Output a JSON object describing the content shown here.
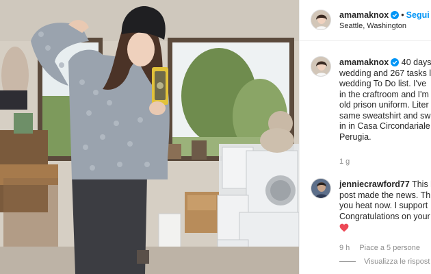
{
  "header": {
    "username": "amamaknox",
    "follow_label": "Segui",
    "location": "Seattle, Washington",
    "icons": {
      "verified": "verified-badge-icon",
      "avatar": "profile-avatar"
    }
  },
  "caption": {
    "username": "amamaknox",
    "lines": [
      "40 days",
      "wedding and 267 tasks l",
      "wedding To Do list. I've",
      "in the craftroom and I'm",
      "old prison uniform. Liter",
      "same sweatshirt and swe",
      "in in Casa Circondariale",
      "Perugia."
    ],
    "time": "1 g"
  },
  "comment": {
    "username": "jenniecrawford77",
    "lines": [
      "This l",
      "post made the news. Th",
      "you heat now. I support",
      "Congratulations on your"
    ],
    "time": "9 h",
    "likes": "Piace a 5 persone",
    "view_replies": "Visualizza le rispost",
    "heart_color": "#ed4956"
  },
  "colors": {
    "link": "#0095f6",
    "muted": "#8e8e8e",
    "text": "#262626"
  }
}
